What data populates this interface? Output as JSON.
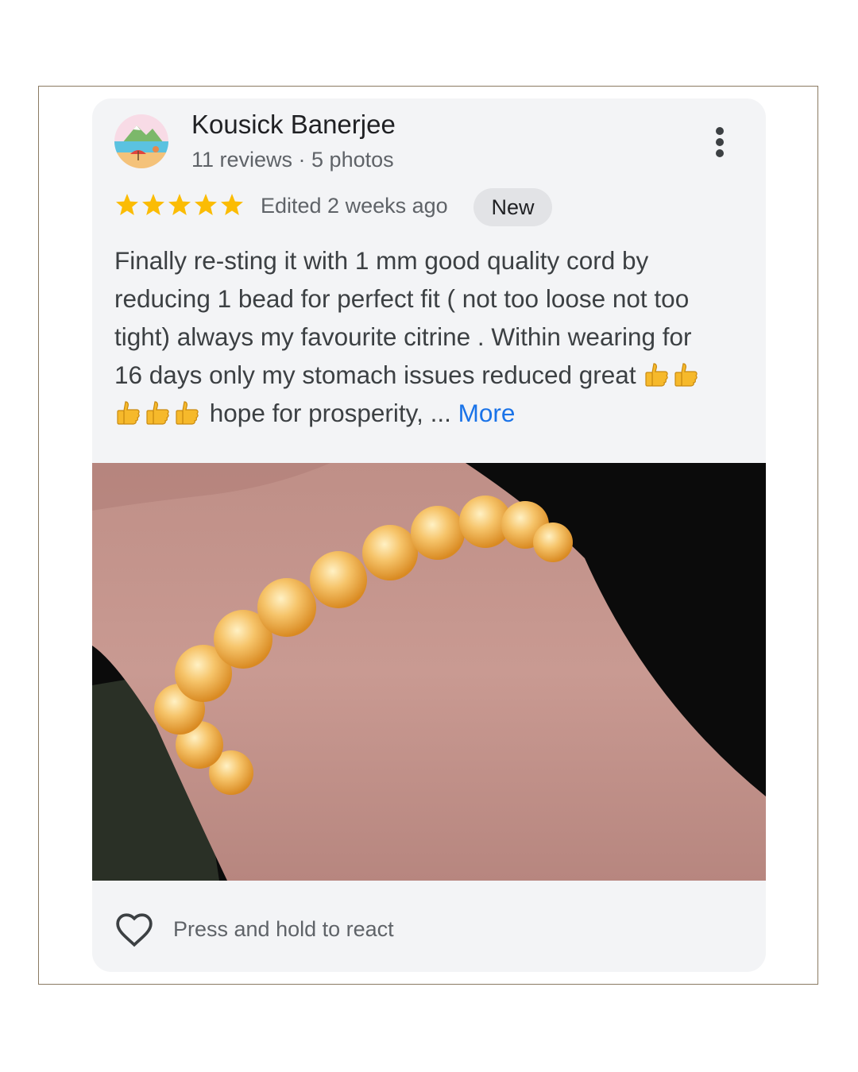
{
  "review": {
    "author_name": "Kousick Banerjee",
    "author_meta": "11 reviews · 5 photos",
    "rating": 5,
    "rating_max": 5,
    "edited": "Edited 2 weeks ago",
    "badge": "New",
    "text_lines": [
      "Finally re-sting it with 1 mm good quality cord by",
      "reducing 1 bead for perfect fit ( not too loose not too",
      "tight) always my favourite citrine . Within wearing for",
      "16 days only my stomach issues reduced great"
    ],
    "text_last": "hope for prosperity, ...",
    "more_label": "More",
    "thumbs_line4": 2,
    "thumbs_line5": 3
  },
  "footer": {
    "react_label": "Press and hold to react"
  },
  "icons": {
    "avatar": "landscape-avatar-icon",
    "menu": "more-vert-icon",
    "star": "star-icon",
    "thumb": "thumbs-up-emoji-icon",
    "react": "heart-outline-icon"
  },
  "colors": {
    "card_background": "#f3f4f6",
    "star": "#fbbc04",
    "link": "#1a73e8",
    "badge_background": "#e2e3e6",
    "frame_border": "#8a7a62"
  }
}
